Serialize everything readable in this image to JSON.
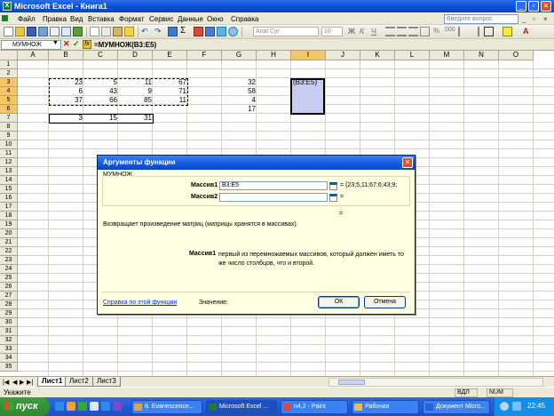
{
  "window": {
    "title": "Microsoft Excel - Книга1"
  },
  "menu": [
    "Файл",
    "Правка",
    "Вид",
    "Вставка",
    "Формат",
    "Сервис",
    "Данные",
    "Окно",
    "Справка"
  ],
  "help_search": {
    "placeholder": "Введите вопрос"
  },
  "toolbar": {
    "font": "Arial Cyr",
    "size": "10"
  },
  "formula_bar": {
    "name_box": "МУМНОЖ",
    "formula": "=МУМНОЖ(B3:E5)"
  },
  "columns": [
    "A",
    "B",
    "C",
    "D",
    "E",
    "F",
    "G",
    "H",
    "I",
    "J",
    "K",
    "L",
    "M",
    "N",
    "O"
  ],
  "rows": [
    "1",
    "2",
    "3",
    "4",
    "5",
    "6",
    "7",
    "8",
    "9",
    "10",
    "11",
    "12",
    "13",
    "14",
    "15",
    "16",
    "17",
    "18",
    "19",
    "20",
    "21",
    "22",
    "23",
    "24",
    "25",
    "26",
    "27",
    "28",
    "29",
    "30",
    "31",
    "32",
    "33",
    "34",
    "35"
  ],
  "cells": {
    "B3": "23",
    "C3": "5",
    "D3": "11",
    "E3": "67",
    "B4": "6",
    "C4": "43",
    "D4": "9",
    "E4": "71",
    "B5": "37",
    "C5": "66",
    "D5": "85",
    "E5": "11",
    "B7": "3",
    "C7": "15",
    "D7": "31",
    "G3": "32",
    "G4": "58",
    "G5": "4",
    "G6": "17",
    "I3": "(B3:E5)"
  },
  "dialog": {
    "title": "Аргументы функции",
    "function_name": "МУМНОЖ",
    "arg1_label": "Массив1",
    "arg1_value": "B3:E5",
    "arg1_result": "= {23;5;11;67:6;43;9;",
    "arg2_label": "Массив2",
    "arg2_value": "",
    "arg2_result": "=",
    "result_eq": "=",
    "description": "Возвращает произведение матриц (матрицы хранятся в массивах).",
    "arg_help_name": "Массив1",
    "arg_help_text": "первый из перемножаемых массивов, который должен иметь то же число столбцов, что и второй.",
    "help_link": "Справка по этой функции",
    "value_label": "Значение:",
    "ok": "ОК",
    "cancel": "Отмена"
  },
  "sheets": [
    "Лист1",
    "Лист2",
    "Лист3"
  ],
  "status": {
    "mode": "Укажите",
    "vdl": "ВДЛ",
    "num": "NUM"
  },
  "taskbar": {
    "start": "пуск",
    "items": [
      "6. Evanescence...",
      "Microsoft Excel ...",
      "n4,2 - Paint",
      "Рабочая",
      "Документ Micro..."
    ],
    "clock": "22:45"
  },
  "colors": {
    "title_blue": "#0a4fd0",
    "dialog_bg": "#ffffe1",
    "selection": "#c8ccf0",
    "taskbar": "#245edb",
    "start_green": "#2b8a2b"
  }
}
